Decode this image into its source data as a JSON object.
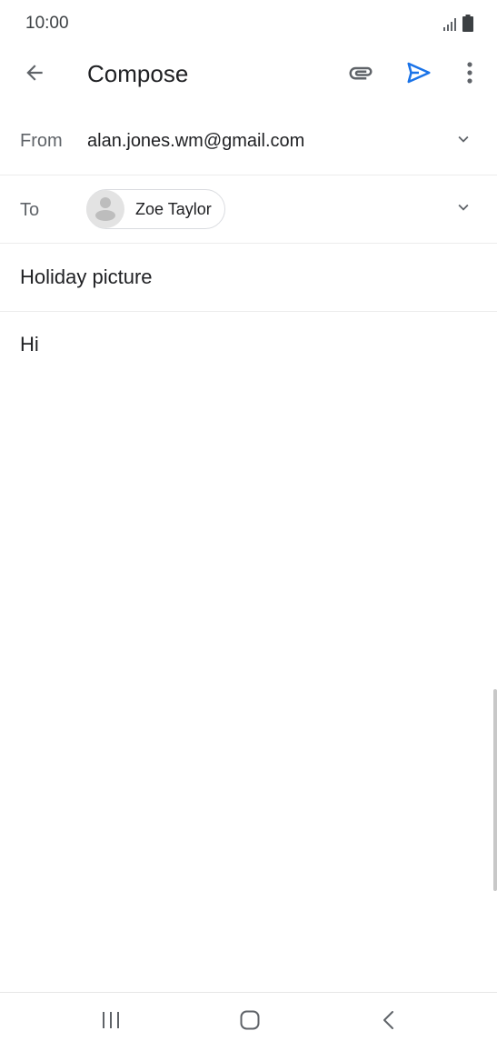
{
  "status_bar": {
    "time": "10:00",
    "icons": [
      "signal-icon",
      "battery-icon"
    ]
  },
  "app_bar": {
    "title": "Compose",
    "icons": [
      "back-arrow-icon",
      "paperclip-icon",
      "send-icon",
      "more-vert-icon"
    ]
  },
  "colors": {
    "send_accent": "#1a73e8",
    "icon_gray": "#5f6368",
    "text_primary": "#202124",
    "divider": "#ececec"
  },
  "from": {
    "label": "From",
    "value": "alan.jones.wm@gmail.com"
  },
  "to": {
    "label": "To",
    "recipients": [
      {
        "name": "Zoe Taylor"
      }
    ]
  },
  "subject": {
    "value": "Holiday picture"
  },
  "body": {
    "value": "Hi"
  },
  "nav_bar": {
    "icons": [
      "recent-apps-icon",
      "home-icon",
      "nav-back-icon"
    ]
  }
}
